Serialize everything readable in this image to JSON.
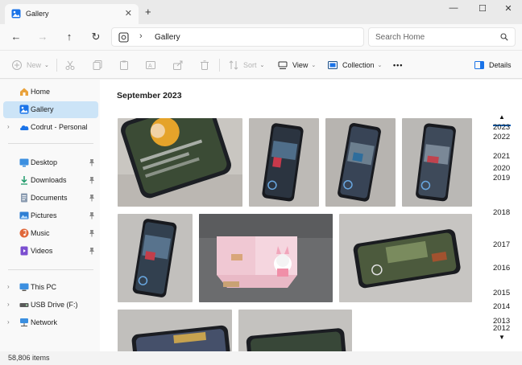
{
  "window": {
    "tab_label": "Gallery",
    "tab_close": "✕",
    "new_tab": "+",
    "minimize": "—",
    "maximize": "☐",
    "close": "✕"
  },
  "address": {
    "breadcrumb_sep": "›",
    "crumb": "Gallery",
    "search_placeholder": "Search Home"
  },
  "toolbar": {
    "new": "New",
    "sort": "Sort",
    "view": "View",
    "collection": "Collection",
    "more": "•••",
    "details": "Details"
  },
  "sidebar": {
    "items": [
      {
        "label": "Home",
        "icon": "home-icon"
      },
      {
        "label": "Gallery",
        "icon": "gallery-icon",
        "selected": true
      },
      {
        "label": "Codrut - Personal",
        "icon": "onedrive-cloud-icon"
      },
      {
        "label": "Desktop",
        "icon": "desktop-folder-icon",
        "pinned": true
      },
      {
        "label": "Downloads",
        "icon": "downloads-folder-icon",
        "pinned": true
      },
      {
        "label": "Documents",
        "icon": "documents-folder-icon",
        "pinned": true
      },
      {
        "label": "Pictures",
        "icon": "pictures-folder-icon",
        "pinned": true
      },
      {
        "label": "Music",
        "icon": "music-folder-icon",
        "pinned": true
      },
      {
        "label": "Videos",
        "icon": "videos-folder-icon",
        "pinned": true
      },
      {
        "label": "This PC",
        "icon": "this-pc-icon"
      },
      {
        "label": "USB Drive (F:)",
        "icon": "usb-drive-icon"
      },
      {
        "label": "Network",
        "icon": "network-icon"
      }
    ]
  },
  "main": {
    "section_title": "September 2023",
    "timeline_years": [
      "2023",
      "2022",
      "2021",
      "2020",
      "2019",
      "2018",
      "2017",
      "2016",
      "2015",
      "2014",
      "2013",
      "2012"
    ],
    "timeline_up": "▲",
    "timeline_down": "▼"
  },
  "status": {
    "item_count": "58,806 items"
  },
  "colors": {
    "accent": "#005fb8",
    "selected_bg": "#cce4f7"
  }
}
